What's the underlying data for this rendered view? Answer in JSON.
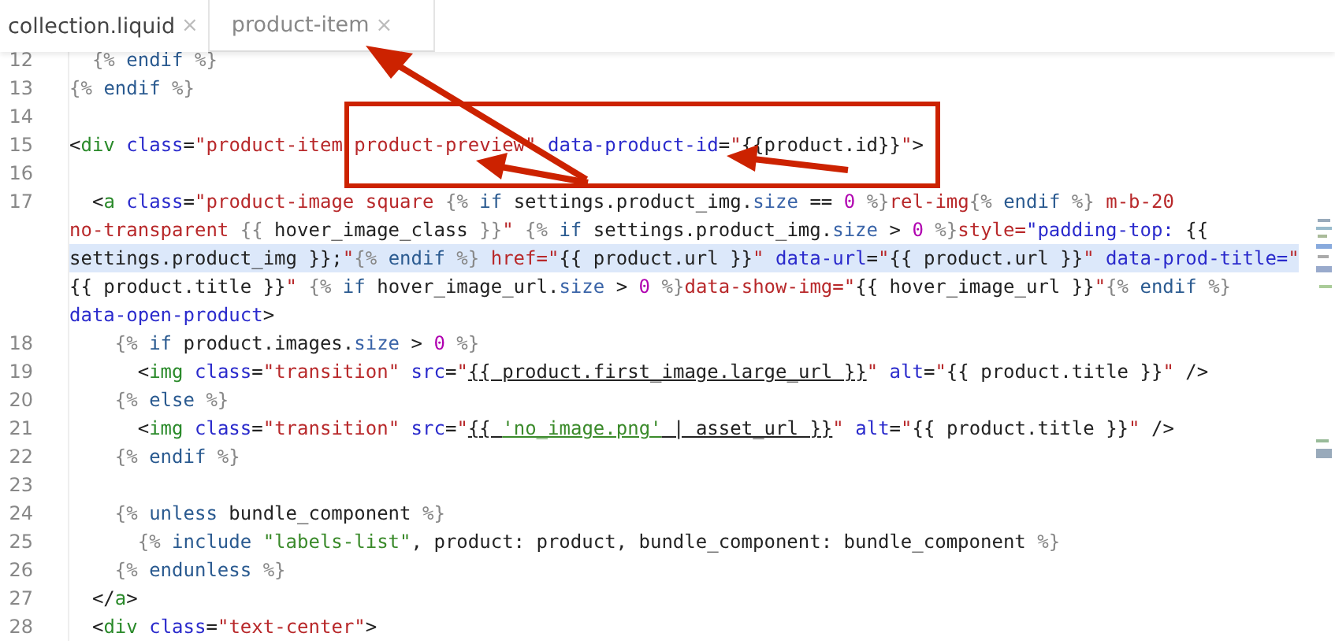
{
  "tabs": [
    {
      "label": "collection.liquid",
      "close": "×",
      "selected": true
    },
    {
      "label": "product-item",
      "close": "×",
      "selected": false
    }
  ],
  "editor": {
    "rows": [
      {
        "number": "12",
        "highlighted": false,
        "tokens": [
          {
            "kind": "delim",
            "text": "  {% "
          },
          {
            "kind": "keyword",
            "text": "endif"
          },
          {
            "kind": "delim",
            "text": " %}"
          }
        ]
      },
      {
        "number": "13",
        "highlighted": false,
        "tokens": [
          {
            "kind": "delim",
            "text": "{% "
          },
          {
            "kind": "keyword",
            "text": "endif"
          },
          {
            "kind": "delim",
            "text": " %}"
          }
        ]
      },
      {
        "number": "14",
        "highlighted": false
      },
      {
        "number": "15",
        "highlighted": false,
        "tokens": [
          {
            "kind": "plain",
            "text": "<"
          },
          {
            "kind": "tag",
            "text": "div"
          },
          {
            "kind": "attr",
            "text": " class"
          },
          {
            "kind": "plain",
            "text": "="
          },
          {
            "kind": "string",
            "text": "\"product-item product-preview\""
          },
          {
            "kind": "attr",
            "text": " data-product-id"
          },
          {
            "kind": "plain",
            "text": "="
          },
          {
            "kind": "string",
            "text": "\""
          },
          {
            "kind": "plain",
            "text": "{{product.id}}"
          },
          {
            "kind": "string",
            "text": "\""
          },
          {
            "kind": "plain",
            "text": ">"
          }
        ]
      },
      {
        "number": "16",
        "highlighted": false
      },
      {
        "number": "17",
        "highlighted": false,
        "tokens": [
          {
            "kind": "plain",
            "text": "  <"
          },
          {
            "kind": "tag",
            "text": "a"
          },
          {
            "kind": "attr",
            "text": " class"
          },
          {
            "kind": "plain",
            "text": "="
          },
          {
            "kind": "string",
            "text": "\"product-image square "
          },
          {
            "kind": "delim",
            "text": "{% "
          },
          {
            "kind": "keyword",
            "text": "if"
          },
          {
            "kind": "plain",
            "text": " settings.product_img."
          },
          {
            "kind": "prop",
            "text": "size"
          },
          {
            "kind": "plain",
            "text": " == "
          },
          {
            "kind": "number",
            "text": "0"
          },
          {
            "kind": "delim",
            "text": " %}"
          },
          {
            "kind": "string",
            "text": "rel-img"
          },
          {
            "kind": "delim",
            "text": "{% "
          },
          {
            "kind": "keyword",
            "text": "endif"
          },
          {
            "kind": "delim",
            "text": " %}"
          },
          {
            "kind": "string",
            "text": " m-b-20"
          }
        ]
      },
      {
        "highlighted": false,
        "tokens": [
          {
            "kind": "string",
            "text": "no-transparent "
          },
          {
            "kind": "delim",
            "text": "{{"
          },
          {
            "kind": "plain",
            "text": " hover_image_class "
          },
          {
            "kind": "delim",
            "text": "}}"
          },
          {
            "kind": "string",
            "text": "\""
          },
          {
            "kind": "delim",
            "text": " {% "
          },
          {
            "kind": "keyword",
            "text": "if"
          },
          {
            "kind": "plain",
            "text": " settings.product_img."
          },
          {
            "kind": "prop",
            "text": "size"
          },
          {
            "kind": "plain",
            "text": " > "
          },
          {
            "kind": "number",
            "text": "0"
          },
          {
            "kind": "delim",
            "text": " %}"
          },
          {
            "kind": "string",
            "text": "style="
          },
          {
            "kind": "attr",
            "text": "\"padding-top:"
          },
          {
            "kind": "plain",
            "text": " {{"
          }
        ]
      },
      {
        "highlighted": true,
        "tokens": [
          {
            "kind": "plain",
            "text": "settings.product_img }};"
          },
          {
            "kind": "string",
            "text": "\""
          },
          {
            "kind": "delim",
            "text": "{% "
          },
          {
            "kind": "keyword",
            "text": "endif"
          },
          {
            "kind": "delim",
            "text": " %}"
          },
          {
            "kind": "string",
            "text": " href=\""
          },
          {
            "kind": "plain",
            "text": "{{ product.url }}"
          },
          {
            "kind": "string",
            "text": "\""
          },
          {
            "kind": "attr",
            "text": " data-url"
          },
          {
            "kind": "plain",
            "text": "="
          },
          {
            "kind": "string",
            "text": "\""
          },
          {
            "kind": "plain",
            "text": "{{ product.url }}"
          },
          {
            "kind": "string",
            "text": "\""
          },
          {
            "kind": "attr",
            "text": " data-prod-title="
          },
          {
            "kind": "string",
            "text": "\""
          }
        ]
      },
      {
        "highlighted": false,
        "tokens": [
          {
            "kind": "plain",
            "text": "{{ product.title }}"
          },
          {
            "kind": "string",
            "text": "\""
          },
          {
            "kind": "delim",
            "text": " {% "
          },
          {
            "kind": "keyword",
            "text": "if"
          },
          {
            "kind": "plain",
            "text": " hover_image_url."
          },
          {
            "kind": "prop",
            "text": "size"
          },
          {
            "kind": "plain",
            "text": " > "
          },
          {
            "kind": "number",
            "text": "0"
          },
          {
            "kind": "delim",
            "text": " %}"
          },
          {
            "kind": "string",
            "text": "data-show-img=\""
          },
          {
            "kind": "plain",
            "text": "{{ hover_image_url }}"
          },
          {
            "kind": "string",
            "text": "\""
          },
          {
            "kind": "delim",
            "text": "{% "
          },
          {
            "kind": "keyword",
            "text": "endif"
          },
          {
            "kind": "delim",
            "text": " %}"
          }
        ]
      },
      {
        "highlighted": false,
        "tokens": [
          {
            "kind": "attr",
            "text": "data-open-product"
          },
          {
            "kind": "plain",
            "text": ">"
          }
        ]
      },
      {
        "number": "18",
        "highlighted": false,
        "tokens": [
          {
            "kind": "delim",
            "text": "    {% "
          },
          {
            "kind": "keyword",
            "text": "if"
          },
          {
            "kind": "plain",
            "text": " product.images."
          },
          {
            "kind": "prop",
            "text": "size"
          },
          {
            "kind": "plain",
            "text": " > "
          },
          {
            "kind": "number",
            "text": "0"
          },
          {
            "kind": "delim",
            "text": " %}"
          }
        ]
      },
      {
        "number": "19",
        "highlighted": false,
        "tokens": [
          {
            "kind": "plain",
            "text": "      <"
          },
          {
            "kind": "tag",
            "text": "img"
          },
          {
            "kind": "attr",
            "text": " class"
          },
          {
            "kind": "plain",
            "text": "="
          },
          {
            "kind": "string",
            "text": "\"transition\""
          },
          {
            "kind": "attr",
            "text": " src"
          },
          {
            "kind": "plain",
            "text": "="
          },
          {
            "kind": "string",
            "text": "\""
          },
          {
            "kind": "link",
            "text": "{{ product.first_image.large_url }}"
          },
          {
            "kind": "string",
            "text": "\""
          },
          {
            "kind": "attr",
            "text": " alt"
          },
          {
            "kind": "plain",
            "text": "="
          },
          {
            "kind": "string",
            "text": "\""
          },
          {
            "kind": "plain",
            "text": "{{ product.title }}"
          },
          {
            "kind": "string",
            "text": "\""
          },
          {
            "kind": "plain",
            "text": " />"
          }
        ]
      },
      {
        "number": "20",
        "highlighted": false,
        "tokens": [
          {
            "kind": "delim",
            "text": "    {% "
          },
          {
            "kind": "keyword",
            "text": "else"
          },
          {
            "kind": "delim",
            "text": " %}"
          }
        ]
      },
      {
        "number": "21",
        "highlighted": false,
        "tokens": [
          {
            "kind": "plain",
            "text": "      <"
          },
          {
            "kind": "tag",
            "text": "img"
          },
          {
            "kind": "attr",
            "text": " class"
          },
          {
            "kind": "plain",
            "text": "="
          },
          {
            "kind": "string",
            "text": "\"transition\""
          },
          {
            "kind": "attr",
            "text": " src"
          },
          {
            "kind": "plain",
            "text": "="
          },
          {
            "kind": "string",
            "text": "\""
          },
          {
            "kind": "link",
            "text": "{{ "
          },
          {
            "kind": "link-literal",
            "text": "'no_image.png'"
          },
          {
            "kind": "link",
            "text": " | asset_url }}"
          },
          {
            "kind": "string",
            "text": "\""
          },
          {
            "kind": "attr",
            "text": " alt"
          },
          {
            "kind": "plain",
            "text": "="
          },
          {
            "kind": "string",
            "text": "\""
          },
          {
            "kind": "plain",
            "text": "{{ product.title }}"
          },
          {
            "kind": "string",
            "text": "\""
          },
          {
            "kind": "plain",
            "text": " />"
          }
        ]
      },
      {
        "number": "22",
        "highlighted": false,
        "tokens": [
          {
            "kind": "delim",
            "text": "    {% "
          },
          {
            "kind": "keyword",
            "text": "endif"
          },
          {
            "kind": "delim",
            "text": " %}"
          }
        ]
      },
      {
        "number": "23",
        "highlighted": false
      },
      {
        "number": "24",
        "highlighted": false,
        "tokens": [
          {
            "kind": "delim",
            "text": "    {% "
          },
          {
            "kind": "keyword",
            "text": "unless"
          },
          {
            "kind": "plain",
            "text": " bundle_component"
          },
          {
            "kind": "delim",
            "text": " %}"
          }
        ]
      },
      {
        "number": "25",
        "highlighted": false,
        "tokens": [
          {
            "kind": "delim",
            "text": "      {% "
          },
          {
            "kind": "keyword",
            "text": "include"
          },
          {
            "kind": "literal",
            "text": " \"labels-list\""
          },
          {
            "kind": "plain",
            "text": ", product: product, bundle_component: bundle_component"
          },
          {
            "kind": "delim",
            "text": " %}"
          }
        ]
      },
      {
        "number": "26",
        "highlighted": false,
        "tokens": [
          {
            "kind": "delim",
            "text": "    {% "
          },
          {
            "kind": "keyword",
            "text": "endunless"
          },
          {
            "kind": "delim",
            "text": " %}"
          }
        ]
      },
      {
        "number": "27",
        "highlighted": false,
        "tokens": [
          {
            "kind": "plain",
            "text": "  </"
          },
          {
            "kind": "tag",
            "text": "a"
          },
          {
            "kind": "plain",
            "text": ">"
          }
        ]
      },
      {
        "number": "28",
        "highlighted": false,
        "tokens": [
          {
            "kind": "plain",
            "text": "  <"
          },
          {
            "kind": "tag",
            "text": "div"
          },
          {
            "kind": "attr",
            "text": " class"
          },
          {
            "kind": "plain",
            "text": "="
          },
          {
            "kind": "string",
            "text": "\"text-center\""
          },
          {
            "kind": "plain",
            "text": ">"
          }
        ]
      }
    ]
  }
}
